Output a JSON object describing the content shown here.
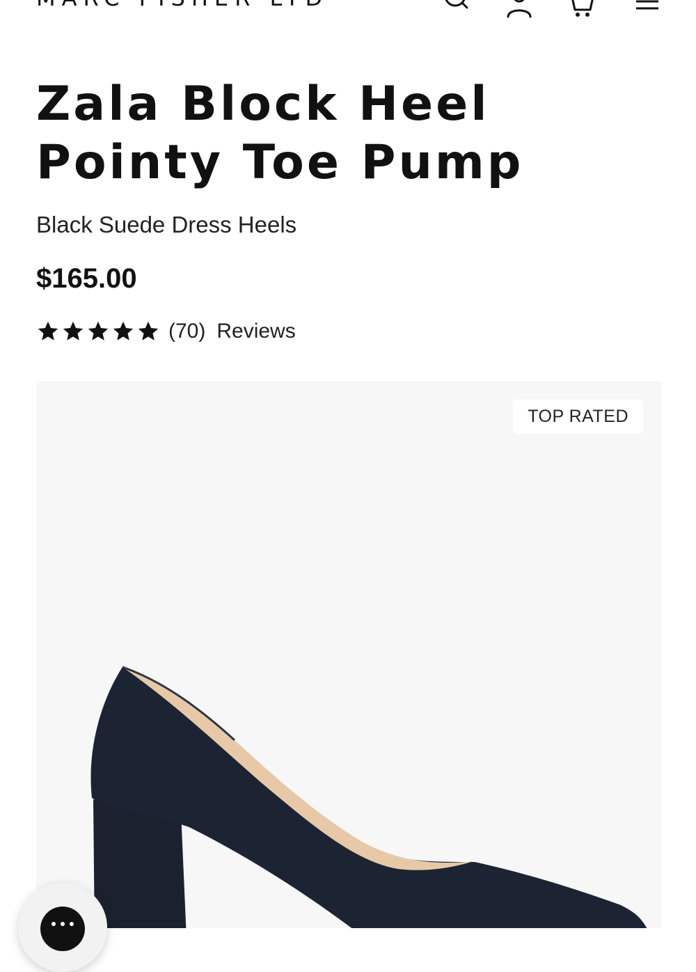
{
  "header": {
    "logo": "MARC FISHER LTD",
    "icons": [
      "search-icon",
      "account-icon",
      "cart-icon",
      "menu-icon"
    ]
  },
  "product": {
    "title": "Zala Block Heel Pointy Toe Pump",
    "subtitle": "Black Suede Dress Heels",
    "price": "$165.00",
    "rating": {
      "stars": 5,
      "count_label": "(70)",
      "reviews_label": "Reviews"
    },
    "badge": "TOP RATED"
  },
  "chat": {
    "icon": "chat-icon"
  },
  "colors": {
    "text": "#111111",
    "media_background": "#f7f7f8",
    "shoe": "#1c2433",
    "lining": "#e7c9a8"
  }
}
